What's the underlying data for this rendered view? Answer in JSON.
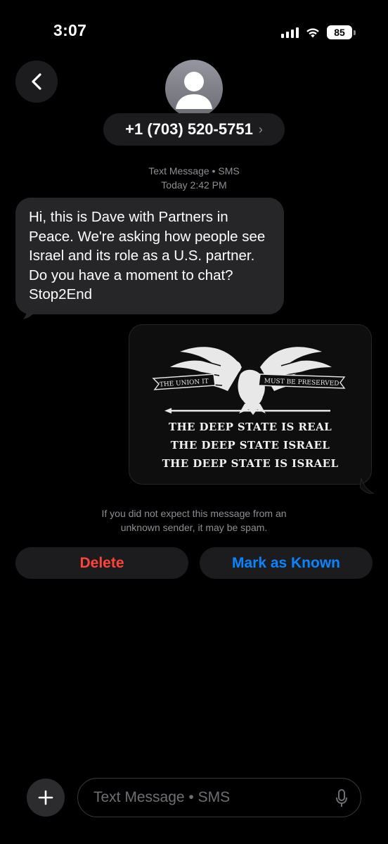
{
  "status_bar": {
    "time": "3:07",
    "battery_level": "85",
    "signal_bars": 4,
    "icons": [
      "cellular-signal-icon",
      "wifi-icon",
      "battery-icon"
    ]
  },
  "header": {
    "back_icon": "chevron-left-icon",
    "avatar_icon": "person-silhouette-icon",
    "contact_number": "+1 (703) 520-5751",
    "chevron": "›"
  },
  "conversation": {
    "service_label": "Text Message • SMS",
    "timestamp": "Today 2:42 PM",
    "messages": [
      {
        "direction": "incoming",
        "type": "text",
        "text": "Hi, this is Dave with Partners in Peace. We're asking how people see Israel and its role as a U.S. partner. Do you have a moment to chat? Stop2End"
      },
      {
        "direction": "outgoing",
        "type": "image",
        "banner_left": "THE UNION IT",
        "banner_right": "MUST BE PRESERVED",
        "lines": [
          "THE DEEP STATE IS REAL",
          "THE DEEP STATE ISRAEL",
          "THE DEEP STATE IS ISRAEL"
        ]
      }
    ]
  },
  "spam_notice": {
    "line1": "If you did not expect this message from an",
    "line2": "unknown sender, it may be spam."
  },
  "actions": {
    "delete_label": "Delete",
    "mark_known_label": "Mark as Known"
  },
  "compose": {
    "plus_icon": "plus-icon",
    "placeholder": "Text Message • SMS",
    "mic_icon": "microphone-icon"
  },
  "colors": {
    "background": "#000000",
    "bubble_incoming": "#262628",
    "button_bg": "#1c1c1e",
    "delete": "#ff453a",
    "accent_blue": "#0a84ff",
    "secondary_text": "#8e8e93"
  }
}
